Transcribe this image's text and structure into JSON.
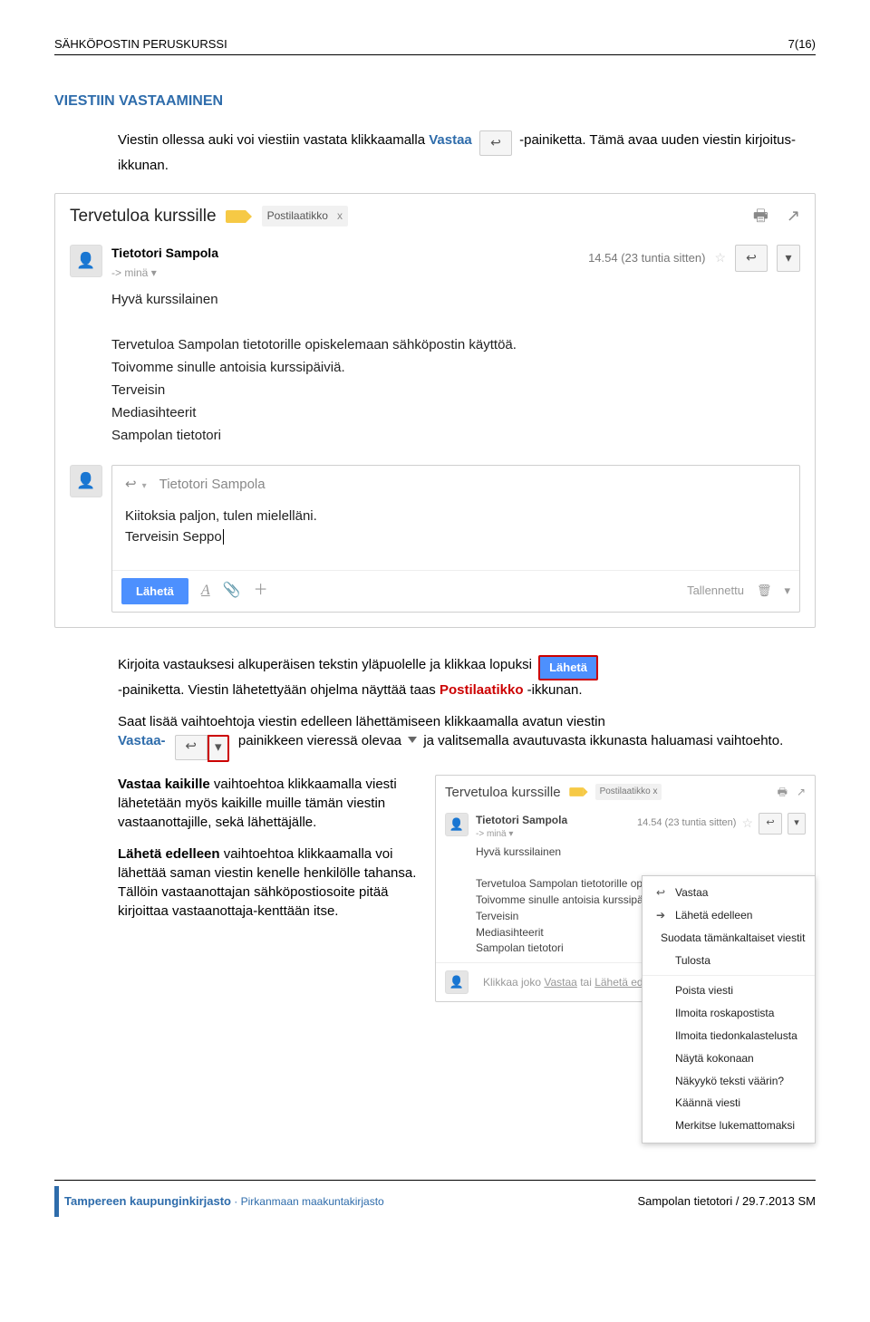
{
  "doc": {
    "header_left": "SÄHKÖPOSTIN PERUSKURSSI",
    "header_right": "7(16)",
    "footer_left_line1": "Tampereen kaupunginkirjasto",
    "footer_left_line2": "Pirkanmaan maakuntakirjasto",
    "footer_right": "Sampolan tietotori / 29.7.2013 SM"
  },
  "section": {
    "heading": "VIESTIIN VASTAAMINEN",
    "para1_a": "Viestin ollessa auki voi viestiin vastata klikkaamalla ",
    "para1_bold": "Vastaa",
    "para1_b": "-painiketta. Tämä avaa uuden viestin kirjoitus-ikkunan.",
    "para2_a": "Kirjoita vastauksesi alkuperäisen tekstin yläpuolelle ja klikkaa lopuksi",
    "btn_send": "Lähetä",
    "para2_b": "-painiketta. Viestin lähetettyään ohjelma näyttää taas ",
    "para2_post": "Postilaatikko",
    "para2_c": " -ikkunan.",
    "para3_a": "Saat lisää vaihtoehtoja viestin edelleen lähettämiseen klikkaamalla avatun viestin",
    "para3_bold": "Vastaa-",
    "para3_b": " painikkeen vieressä olevaa ",
    "para3_c": " ja valitsemalla avautuvasta ikkunasta haluamasi vaihtoehto.",
    "para4_bold": "Vastaa kaikille",
    "para4_rest": " vaihtoehtoa klikkaamalla viesti lähetetään myös kaikille muille tämän viestin vastaanottajille, sekä lähettäjälle.",
    "para5_bold": "Lähetä edelleen",
    "para5_rest": " vaihtoehtoa klikkaamalla voi lähettää saman viestin kenelle henkilölle tahansa. Tällöin vastaanottajan sähköpostiosoite pitää kirjoittaa vastaanottaja-kenttään itse."
  },
  "gmail": {
    "subject": "Tervetuloa kurssille",
    "chip_label": "Postilaatikko",
    "chip_close": "x",
    "sender_name": "Tietotori Sampola",
    "timestamp": "14.54 (23 tuntia sitten)",
    "to_label": "-> minä",
    "body": {
      "l1": "Hyvä kurssilainen",
      "l2": "Tervetuloa Sampolan tietotorille opiskelemaan sähköpostin käyttöä.",
      "l3": "Toivomme sinulle antoisia kurssipäiviä.",
      "l4": "Terveisin",
      "l5": "Mediasihteerit",
      "l6": "Sampolan tietotori"
    },
    "reply": {
      "to": "Tietotori Sampola",
      "l1": "Kiitoksia paljon, tulen mielelläni.",
      "l2": "Terveisin Seppo",
      "send": "Lähetä",
      "saved": "Tallennettu"
    }
  },
  "small_card": {
    "subject": "Tervetuloa kurssille",
    "chip": "Postilaatikko  x",
    "sender": "Tietotori Sampola",
    "time": "14.54 (23 tuntia sitten)",
    "to": "-> minä",
    "b1": "Hyvä kurssilainen",
    "b2": "Tervetuloa Sampolan tietotorille opiske",
    "b3": "Toivomme sinulle antoisia kurssipäiviä",
    "b4": "Terveisin",
    "b5": "Mediasihteerit",
    "b6": "Sampolan tietotori",
    "reply_hint_a": "Klikkaa joko ",
    "reply_link1": "Vastaa",
    "reply_hint_b": " tai ",
    "reply_link2": "Lähetä ede"
  },
  "menu": {
    "m1": "Vastaa",
    "m2": "Lähetä edelleen",
    "m3": "Suodata tämänkaltaiset viestit",
    "m4": "Tulosta",
    "m5": "Poista viesti",
    "m6": "Ilmoita roskapostista",
    "m7": "Ilmoita tiedonkalastelusta",
    "m8": "Näytä kokonaan",
    "m9": "Näkyykö teksti väärin?",
    "m10": "Käännä viesti",
    "m11": "Merkitse lukemattomaksi"
  }
}
